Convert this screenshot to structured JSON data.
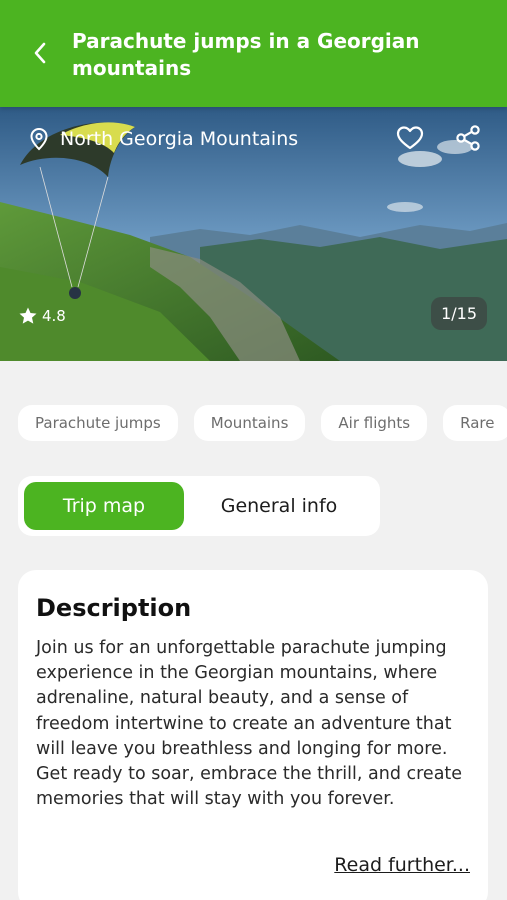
{
  "header": {
    "title": "Parachute jumps in a Georgian mountains"
  },
  "hero": {
    "location": "North Georgia Mountains",
    "rating": "4.8",
    "counter": "1/15"
  },
  "tags": [
    "Parachute jumps",
    "Mountains",
    "Air flights",
    "Rare"
  ],
  "segment": {
    "active": "Trip map",
    "inactive": "General info"
  },
  "description": {
    "title": "Description",
    "body": "Join us for an unforgettable parachute jumping experience in the Georgian mountains, where adrenaline, natural beauty, and a sense of freedom intertwine to create an adventure that will leave you breathless and longing for more. Get ready to soar, embrace the thrill, and create memories that will stay with you forever.",
    "read_more": "Read further..."
  },
  "colors": {
    "accent": "#4cb421",
    "background": "#f1f1f1"
  }
}
